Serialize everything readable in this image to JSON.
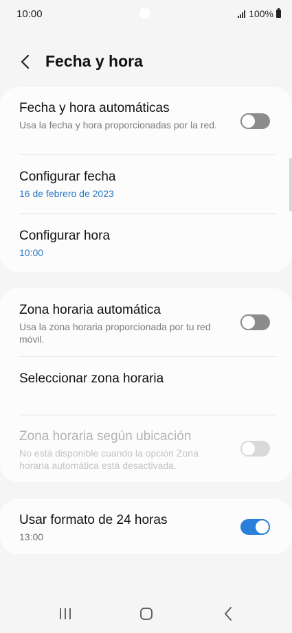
{
  "status_bar": {
    "time": "10:00",
    "battery": "100%"
  },
  "header": {
    "title": "Fecha y hora"
  },
  "section1": {
    "auto_datetime": {
      "title": "Fecha y hora automáticas",
      "subtitle": "Usa la fecha y hora proporcionadas por la red.",
      "enabled": false
    },
    "set_date": {
      "title": "Configurar fecha",
      "value": "16 de febrero de 2023"
    },
    "set_time": {
      "title": "Configurar hora",
      "value": "10:00"
    }
  },
  "section2": {
    "auto_timezone": {
      "title": "Zona horaria automática",
      "subtitle": "Usa la zona horaria proporcionada por tu red móvil.",
      "enabled": false
    },
    "select_timezone": {
      "title": "Seleccionar zona horaria"
    },
    "location_timezone": {
      "title": "Zona horaria según ubicación",
      "subtitle": "No está disponible cuando la opción Zona horaria automática está desactivada.",
      "enabled": false,
      "disabled": true
    }
  },
  "section3": {
    "format_24h": {
      "title": "Usar formato de 24 horas",
      "subtitle": "13:00",
      "enabled": true
    }
  },
  "colors": {
    "accent": "#2a7fdc",
    "link_text": "#2a78c2",
    "background": "#f5f5f5",
    "card": "#fcfcfc"
  },
  "icons": {
    "back": "chevron-left-icon",
    "recents": "recents-icon",
    "home": "home-icon",
    "nav_back": "back-nav-icon"
  }
}
